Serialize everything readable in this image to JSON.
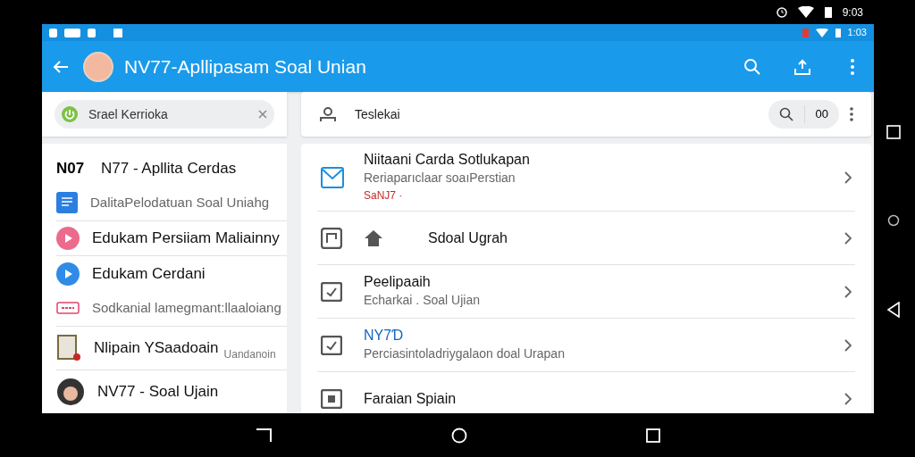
{
  "device_status": {
    "time": "9:03"
  },
  "app_status": {
    "time": "1:03"
  },
  "app_bar": {
    "title": "NV77-Apllipasam Soal Unian"
  },
  "left_search": {
    "value": "Srael Kerrioka"
  },
  "left_list": [
    {
      "kind": "text",
      "icon_text": "N07",
      "title": "N77 - Apllita Cerdas",
      "secondary": false,
      "divider": false
    },
    {
      "kind": "doc",
      "title": "DalitaPelodatuan Soal Uniahg",
      "secondary": true,
      "divider": true
    },
    {
      "kind": "play",
      "color": "#ec6a8c",
      "title": "Edukam Persiiam Maliainny",
      "secondary": false,
      "divider": true
    },
    {
      "kind": "play",
      "color": "#2f8be6",
      "title": "Edukam Cerdani",
      "secondary": false,
      "divider": false
    },
    {
      "kind": "badge",
      "title": "Sodkanial lamegmant:llaaloiang",
      "secondary": true,
      "divider": true
    },
    {
      "kind": "tablet",
      "title": "Nlipain YSaadoain",
      "note": "Uandanoin",
      "secondary": false,
      "divider": true
    },
    {
      "kind": "avatar",
      "title": "NV77 - Soal Ujain",
      "secondary": false,
      "divider": false
    }
  ],
  "right_search": {
    "value": "Teslekai",
    "count": "00"
  },
  "right_list": [
    {
      "kind": "mail",
      "title": "Niitaani Carda Sotlukapan",
      "subtitle": "Reriaparıclaar soaıPerstian",
      "tag": "SaNJ7 ·",
      "accent": false
    },
    {
      "kind": "frame",
      "title": "Sdoal Ugrah",
      "accent": false
    },
    {
      "kind": "check",
      "title": "Peelipaaih",
      "subtitle": "Echarkai . Soal Ujian",
      "accent": false
    },
    {
      "kind": "check",
      "title": "NY7Ɗ",
      "subtitle": "Perciasintoladriygalaon doal Urapan",
      "accent": true
    },
    {
      "kind": "square",
      "title": "Faraian Spiain",
      "accent": false
    }
  ]
}
